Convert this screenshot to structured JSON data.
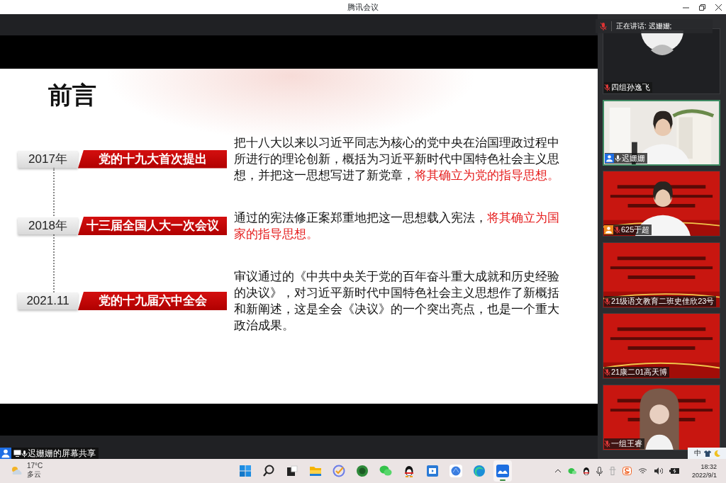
{
  "window": {
    "title": "腾讯会议"
  },
  "speaking_banner": {
    "text": "正在讲话: 迟姗姗;"
  },
  "slide": {
    "heading": "前言",
    "timeline": [
      {
        "year": "2017年",
        "event": "党的十九大首次提出",
        "paragraph": [
          {
            "text": "把十八大以来以习近平同志为核心的党中央在治国理政过程中所进行的理论创新，概括为习近平新时代中国特色社会主义思想，并把这一思想写进了新党章，",
            "highlight": false
          },
          {
            "text": "将其确立为党的指导思想。",
            "highlight": true
          }
        ]
      },
      {
        "year": "2018年",
        "event": "十三届全国人大一次会议",
        "paragraph": [
          {
            "text": "通过的宪法修正案郑重地把这一思想载入宪法，",
            "highlight": false
          },
          {
            "text": "将其确立为国家的指导思想。",
            "highlight": true
          }
        ]
      },
      {
        "year": "2021.11",
        "event": "党的十九届六中全会",
        "paragraph": [
          {
            "text": "审议通过的《中共中央关于党的百年奋斗重大成就和历史经验的决议》，对习近平新时代中国特色社会主义思想作了新概括和新阐述，这是全会《决议》的一个突出亮点，也是一个重大政治成果。",
            "highlight": false
          }
        ]
      }
    ]
  },
  "participants": [
    {
      "name": "四组孙逸飞",
      "kind": "avatar",
      "muted": true,
      "speaking": false
    },
    {
      "name": "迟姗姗",
      "kind": "video",
      "color": "#1f6fe5",
      "muted": false,
      "speaking": true
    },
    {
      "name": "625于超",
      "kind": "video",
      "color": "#f08a1c",
      "muted": true,
      "speaking": false
    },
    {
      "name": "21级语文教育二班史佳欣23号",
      "kind": "video",
      "muted": true,
      "speaking": false
    },
    {
      "name": "21康二01高天博",
      "kind": "video",
      "muted": true,
      "speaking": false
    },
    {
      "name": "一组王睿",
      "kind": "video",
      "muted": true,
      "speaking": false
    }
  ],
  "share_label": {
    "text": "迟姗姗的屏幕共享",
    "color": "#1f6fe5"
  },
  "ime_bar": {
    "mode": "中"
  },
  "taskbar": {
    "weather": {
      "temperature": "17°C",
      "condition": "多云"
    },
    "apps": [
      {
        "kind": "start",
        "active": false
      },
      {
        "kind": "search",
        "active": false
      },
      {
        "kind": "taskview",
        "active": false
      },
      {
        "kind": "folder",
        "active": false
      },
      {
        "kind": "tick",
        "active": false
      },
      {
        "kind": "greenball",
        "active": false
      },
      {
        "kind": "chat",
        "active": false
      },
      {
        "kind": "penguin",
        "active": false
      },
      {
        "kind": "video",
        "active": false
      },
      {
        "kind": "browser",
        "active": false
      },
      {
        "kind": "edge",
        "active": false
      },
      {
        "kind": "meeting",
        "active": true
      }
    ],
    "clock": {
      "time": "18:32",
      "date": "2022/9/1"
    }
  }
}
